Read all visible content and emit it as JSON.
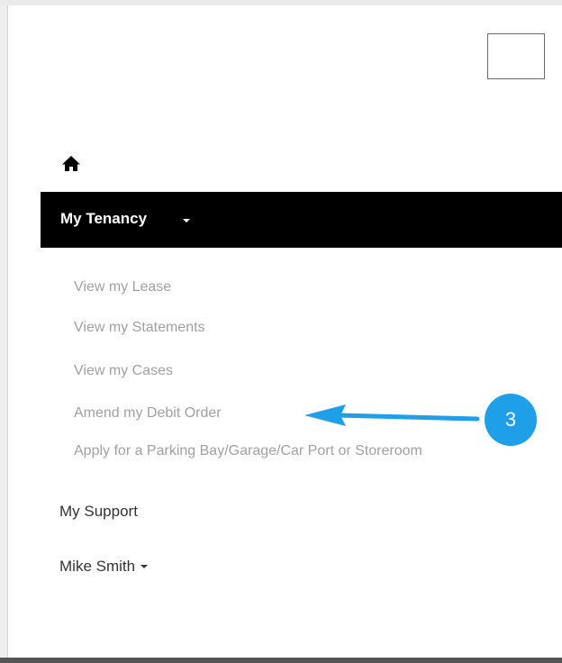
{
  "nav": {
    "home_icon": "home-icon",
    "my_tenancy": {
      "label": "My Tenancy",
      "items": [
        {
          "label": "View my Lease"
        },
        {
          "label": "View my Statements"
        },
        {
          "label": "View my Cases"
        },
        {
          "label": "Amend my Debit Order"
        },
        {
          "label": "Apply for a Parking Bay/Garage/Car Port or Storeroom"
        }
      ]
    },
    "my_support": {
      "label": "My Support"
    },
    "user_menu": {
      "label": "Mike Smith"
    }
  },
  "annotation": {
    "step_number": "3",
    "color": "#1e9fe8"
  },
  "colors": {
    "nav_active_bg": "#000000",
    "submenu_text": "#a0a0a0",
    "nav_text": "#333333"
  }
}
